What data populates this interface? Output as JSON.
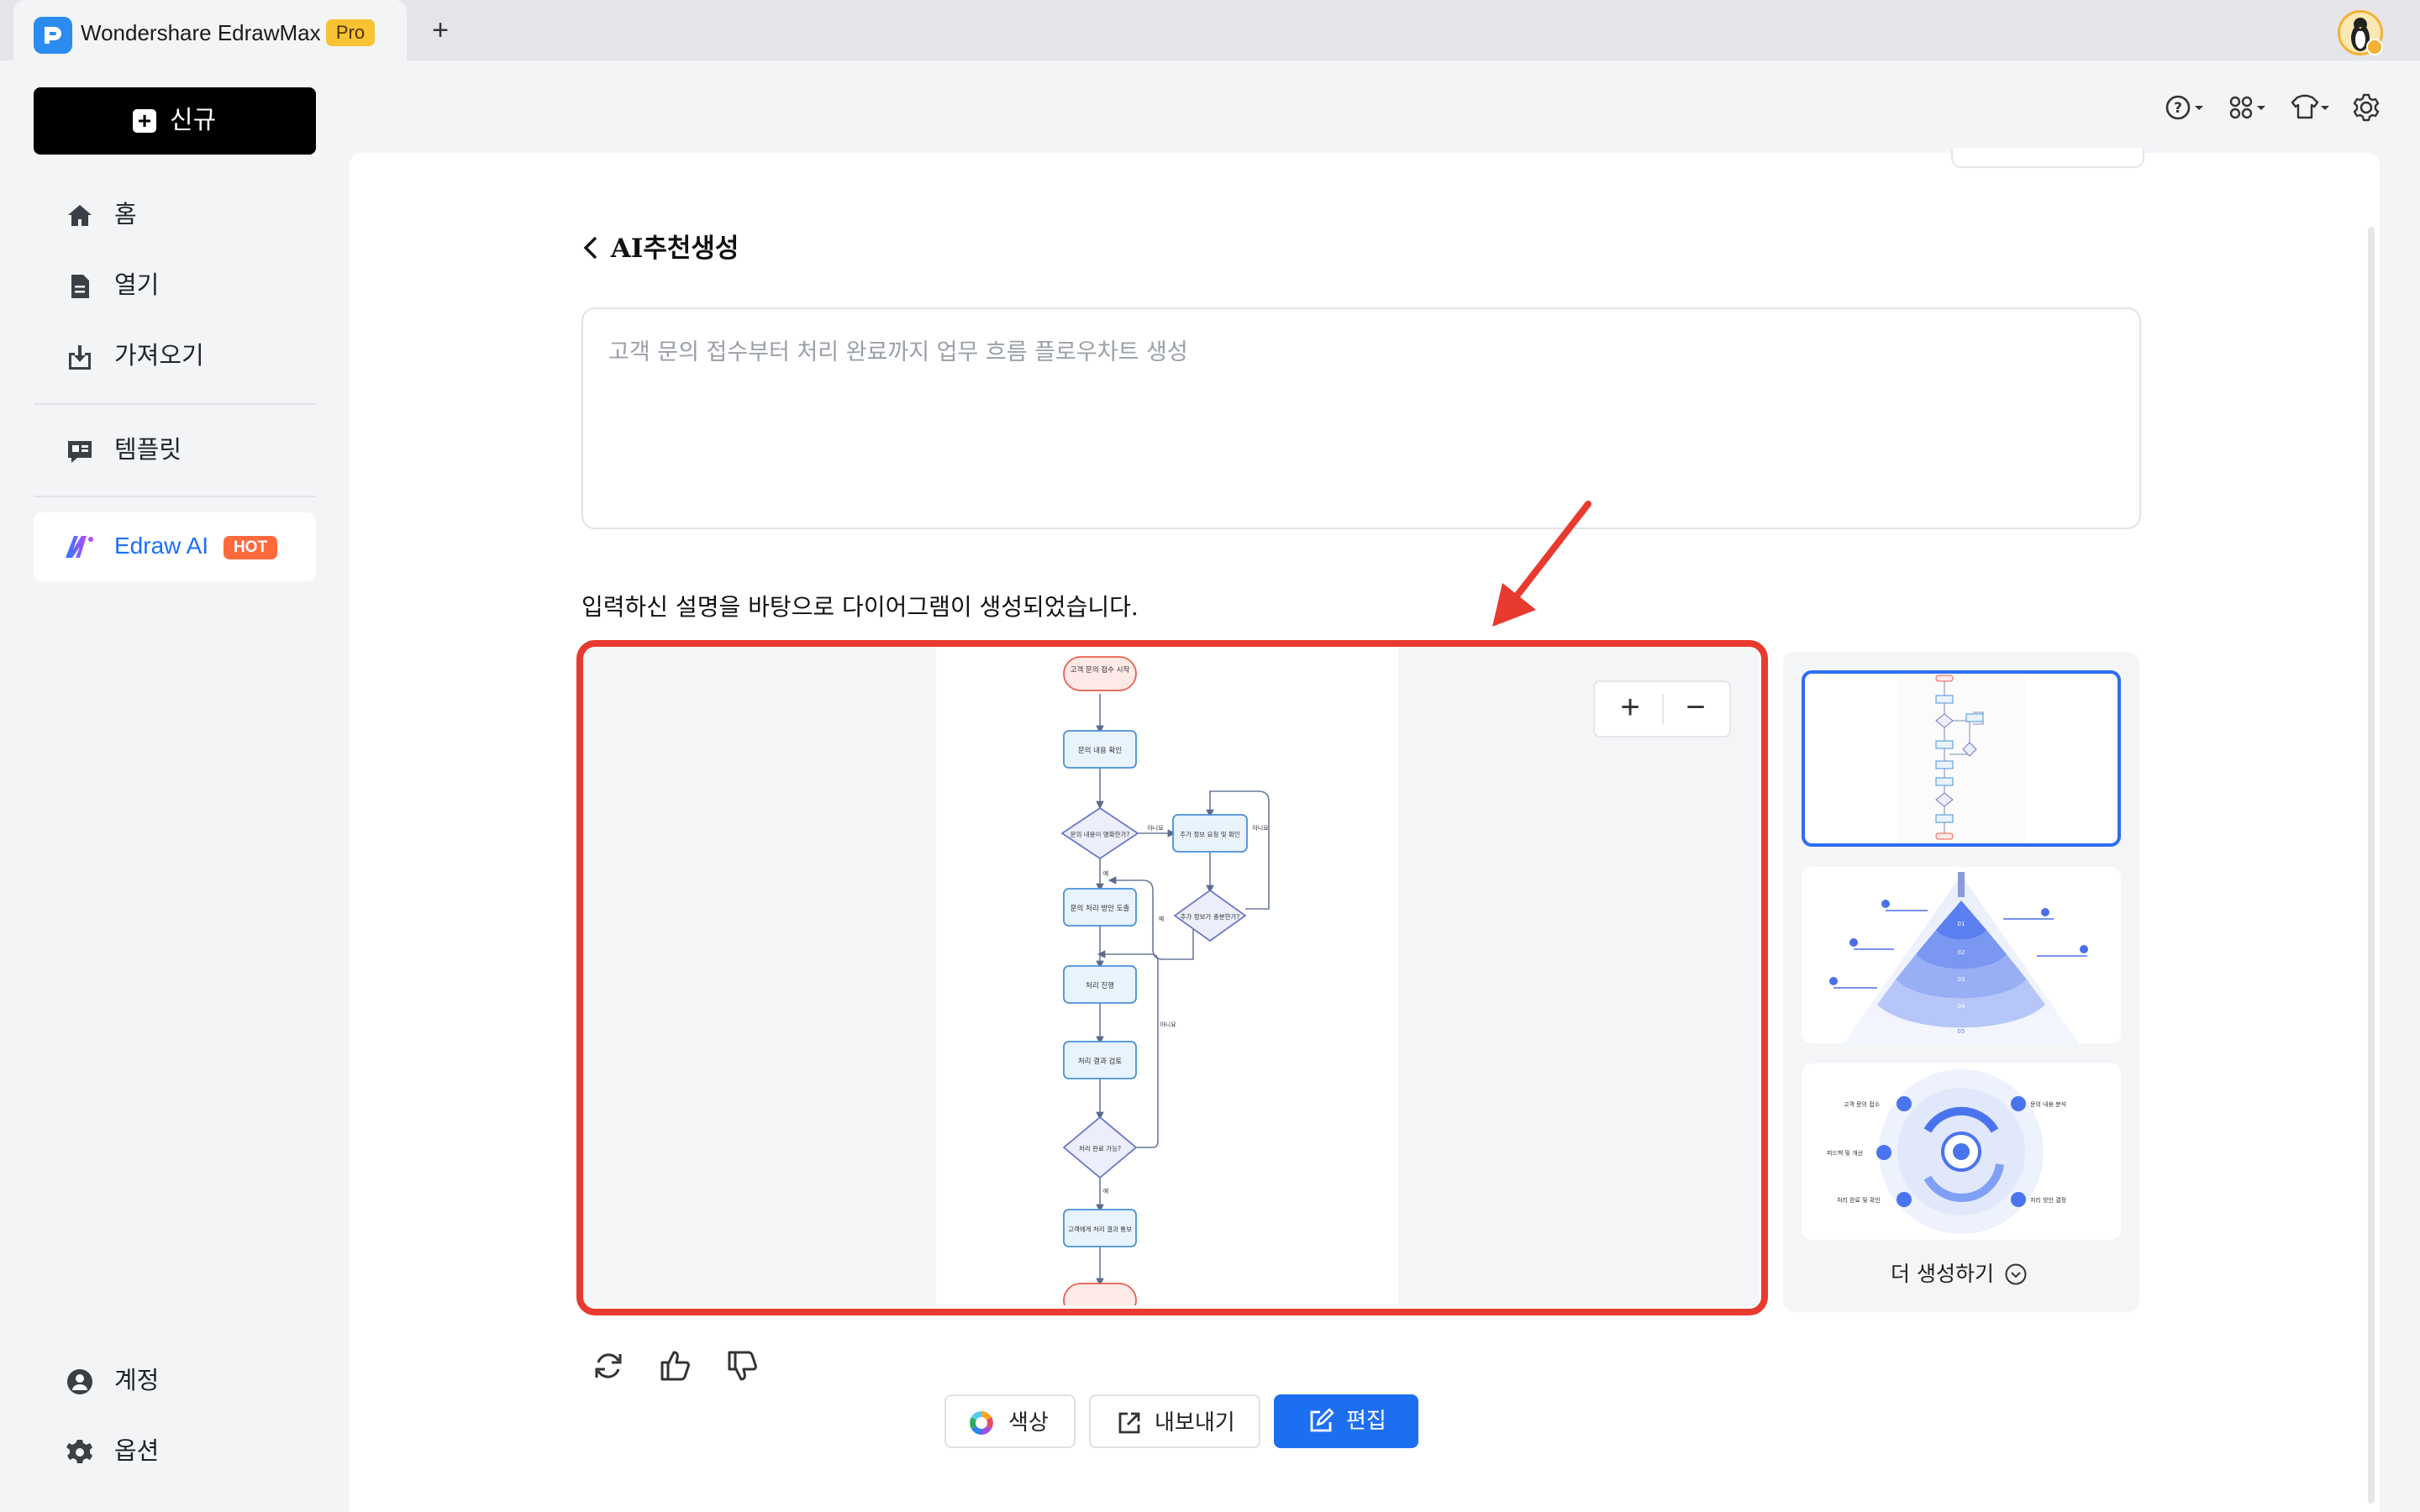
{
  "titlebar": {
    "app_name": "Wondershare EdrawMax",
    "badge": "Pro",
    "new_tab": "+"
  },
  "sidebar": {
    "new_button": "신규",
    "items": [
      {
        "label": "홈",
        "icon": "home-icon"
      },
      {
        "label": "열기",
        "icon": "file-icon"
      },
      {
        "label": "가져오기",
        "icon": "import-icon"
      },
      {
        "label": "템플릿",
        "icon": "template-icon"
      }
    ],
    "ai": {
      "label": "Edraw AI",
      "badge": "HOT"
    },
    "bottom": [
      {
        "label": "계정",
        "icon": "account-icon"
      },
      {
        "label": "옵션",
        "icon": "gear-icon"
      }
    ]
  },
  "toolbar_icons": [
    "help-icon",
    "apps-icon",
    "theme-icon",
    "settings-icon"
  ],
  "page": {
    "title": "AI추천생성",
    "prompt_placeholder": "고객 문의 접수부터 처리 완료까지 업무 흐름 플로우차트 생성",
    "result_message": "입력하신 설명을 바탕으로 다이어그램이 생성되었습니다."
  },
  "flowchart": {
    "start": "고객 문의 접수 시작",
    "step1": "문의 내용 확인",
    "decision1": "문의 내용이 명확한가?",
    "side1": "추가 정보 요청 및 확인",
    "side_decision": "추가 정보가 충분한가?",
    "step2": "문의 처리 방안 도출",
    "step3": "처리 진행",
    "step4": "처리 결과 검토",
    "decision2": "처리 완료 가능?",
    "step5": "고객에게 처리 결과 통보",
    "yes": "예",
    "no": "아니요"
  },
  "preview": {
    "zoom_in": "+",
    "zoom_out": "−"
  },
  "thumbnails": {
    "more_label": "더 생성하기",
    "pyramid_labels": [
      "01",
      "02",
      "03",
      "04",
      "05"
    ],
    "cycle_labels": [
      "고객 문의 접수",
      "문의 내용 분석",
      "피드백 및 개선",
      "처리 완료 및 확인",
      "처리 방안 결정"
    ]
  },
  "actions": {
    "color": "색상",
    "export": "내보내기",
    "edit": "편집"
  },
  "colors": {
    "accent": "#1d6ff2",
    "highlight": "#e83a2e",
    "brand": "#2b8cf0",
    "hot": "#ff6a3d",
    "pro": "#f8c232"
  }
}
